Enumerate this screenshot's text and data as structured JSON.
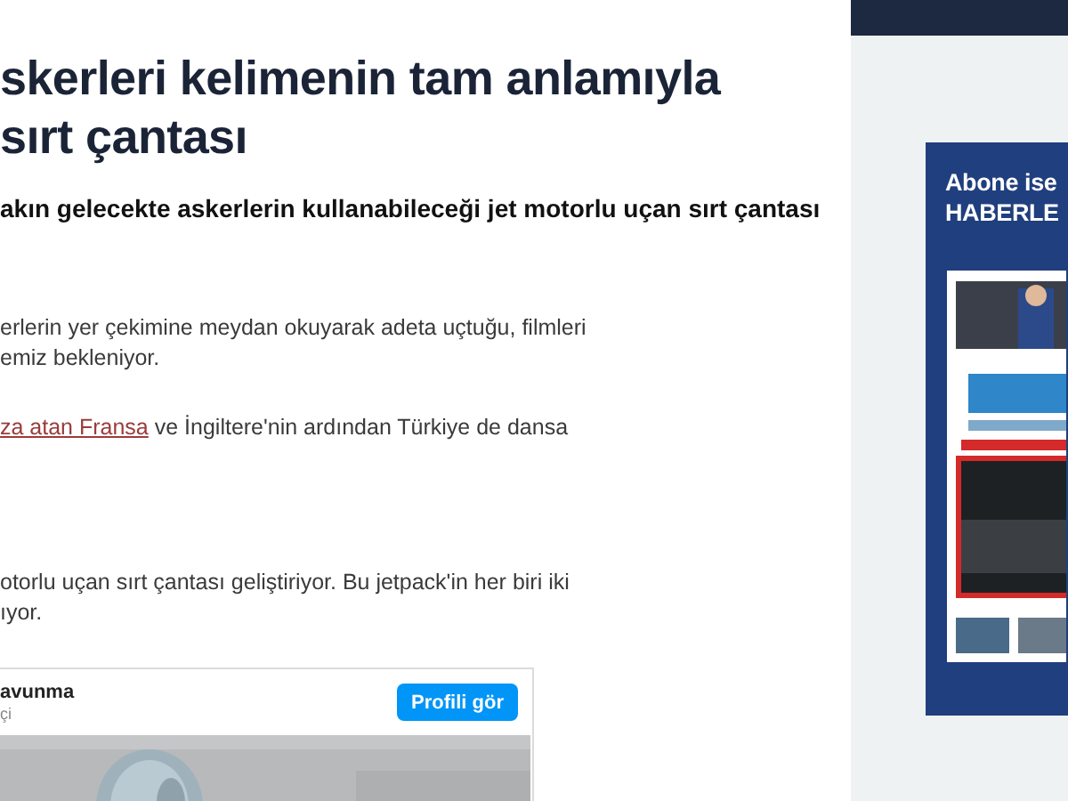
{
  "article": {
    "title_lines": [
      "skerleri kelimenin tam anlamıyla",
      "sırt çantası"
    ],
    "subtitle": "akın gelecekte askerlerin kullanabileceği jet motorlu uçan sırt çantası",
    "paragraphs": [
      {
        "lines": [
          [
            {
              "kind": "text",
              "text": "erlerin yer çekimine meydan okuyarak adeta uçtuğu, filmleri"
            }
          ],
          [
            {
              "kind": "text",
              "text": "emiz bekleniyor."
            }
          ]
        ]
      },
      {
        "lines": [
          [
            {
              "kind": "link",
              "text": "za atan Fransa"
            },
            {
              "kind": "text",
              "text": " ve İngiltere'nin ardından Türkiye de dansa"
            }
          ]
        ]
      },
      {
        "lines": [
          [
            {
              "kind": "text",
              "text": "otorlu uçan sırt çantası geliştiriyor. Bu jetpack'in her biri iki"
            }
          ],
          [
            {
              "kind": "text",
              "text": "ıyor."
            }
          ]
        ]
      }
    ],
    "embed": {
      "account": "avunma",
      "caption": "çi",
      "button": "Profili gör",
      "media": {
        "kind": "picture"
      }
    }
  },
  "sidebar": {
    "promo": {
      "lines": [
        "Abone ise",
        "HABERLE"
      ],
      "cover": {
        "kind": "picture"
      }
    }
  }
}
